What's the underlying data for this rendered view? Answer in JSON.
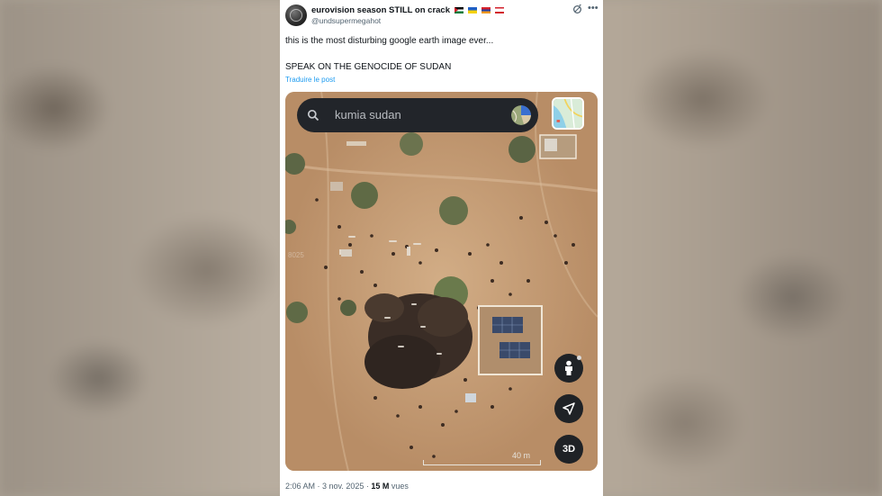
{
  "tweet": {
    "display_name": "eurovision season STILL on crack",
    "flags": [
      "palestine-flag-icon",
      "ukraine-flag-icon",
      "armenia-flag-icon",
      "lebanon-flag-icon"
    ],
    "handle": "@undsupermegahot",
    "text_line1": "this is the most disturbing google earth image ever...",
    "text_line2": "SPEAK ON THE GENOCIDE OF SUDAN",
    "translate_link": "Traduire le post",
    "timestamp": "2:06 AM · 3 nov. 2025 · ",
    "views_count": "15 M",
    "views_label": " vues"
  },
  "map": {
    "search_query": "kumia sudan",
    "scale_label": "40 m",
    "button_3d": "3D",
    "watermark": "8025"
  },
  "colors": {
    "link": "#1d9bf0",
    "text": "#0f1419",
    "muted": "#536471",
    "sand": "#c9a077",
    "map_button": "#1f2226"
  }
}
